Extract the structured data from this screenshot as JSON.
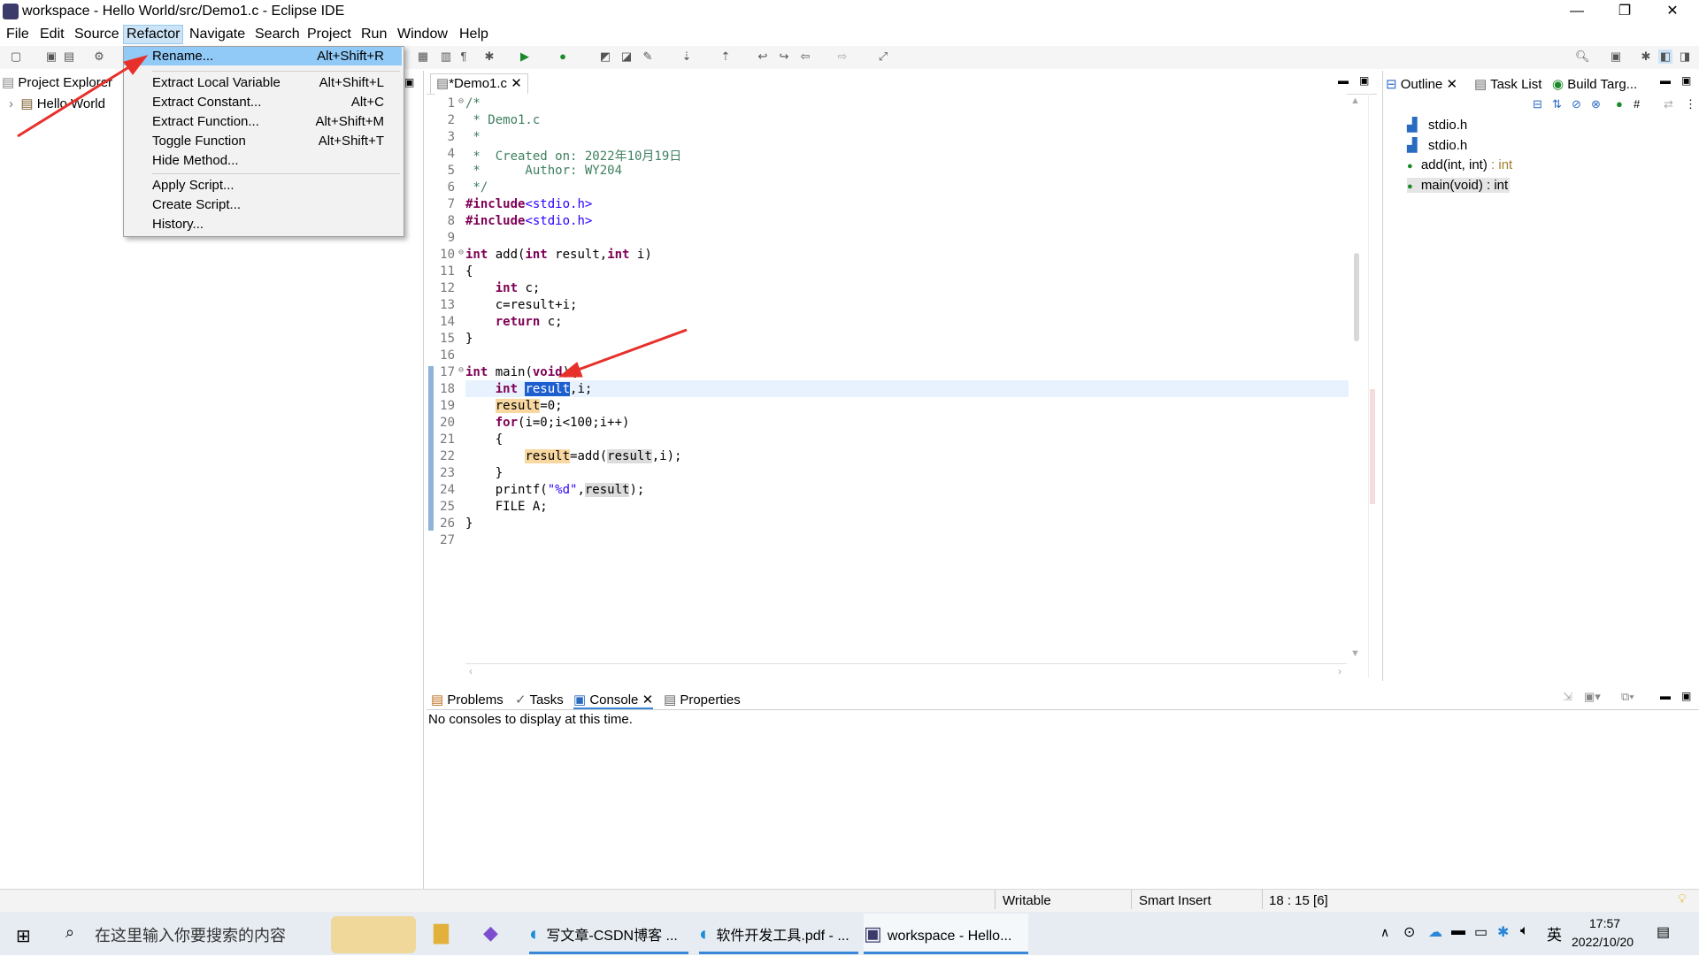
{
  "window": {
    "title": "workspace - Hello World/src/Demo1.c - Eclipse IDE",
    "min": "—",
    "max": "❐",
    "close": "✕"
  },
  "menubar": [
    "File",
    "Edit",
    "Source",
    "Refactor",
    "Navigate",
    "Search",
    "Project",
    "Run",
    "Window",
    "Help"
  ],
  "refactor_menu": {
    "group1": [
      {
        "label": "Rename...",
        "accel": "Alt+Shift+R"
      }
    ],
    "group2": [
      {
        "label": "Extract Local Variable",
        "accel": "Alt+Shift+L"
      },
      {
        "label": "Extract Constant...",
        "accel": "Alt+C"
      },
      {
        "label": "Extract Function...",
        "accel": "Alt+Shift+M"
      },
      {
        "label": "Toggle Function",
        "accel": "Alt+Shift+T"
      },
      {
        "label": "Hide Method...",
        "accel": ""
      }
    ],
    "group3": [
      {
        "label": "Apply Script...",
        "accel": ""
      },
      {
        "label": "Create Script...",
        "accel": ""
      },
      {
        "label": "History...",
        "accel": ""
      }
    ]
  },
  "project_explorer": {
    "tab": "Project Explorer",
    "items": [
      "Hello World"
    ]
  },
  "editor": {
    "tab": "*Demo1.c",
    "line_numbers": [
      "1",
      "2",
      "3",
      "4",
      "5",
      "6",
      "7",
      "8",
      "9",
      "10",
      "11",
      "12",
      "13",
      "14",
      "15",
      "16",
      "17",
      "18",
      "19",
      "20",
      "21",
      "22",
      "23",
      "24",
      "25",
      "26",
      "27"
    ],
    "lines": [
      "/*",
      " * Demo1.c",
      " *",
      " *  Created on: 2022年10月19日",
      " *      Author: WY204",
      " */",
      "#include<stdio.h>",
      "#include<stdio.h>",
      "",
      "int add(int result,int i)",
      "{",
      "    int c;",
      "    c=result+i;",
      "    return c;",
      "}",
      "",
      "int main(void){",
      "    int result,i;",
      "    result=0;",
      "    for(i=0;i<100;i++)",
      "    {",
      "        result=add(result,i);",
      "    }",
      "    printf(\"%d\",result);",
      "    FILE A;",
      "}",
      ""
    ],
    "selected_word": "result"
  },
  "outline": {
    "tabs": [
      "Outline",
      "Task List",
      "Build Targ..."
    ],
    "items": [
      {
        "name": "stdio.h",
        "type": ""
      },
      {
        "name": "stdio.h",
        "type": ""
      },
      {
        "name": "add(int, int)",
        "type": " : int"
      },
      {
        "name": "main(void)",
        "type": " : int"
      }
    ]
  },
  "console": {
    "tabs": [
      "Problems",
      "Tasks",
      "Console",
      "Properties"
    ],
    "message": "No consoles to display at this time."
  },
  "status": {
    "writable": "Writable",
    "insert_mode": "Smart Insert",
    "position": "18 : 15 [6]"
  },
  "taskbar": {
    "search_placeholder": "在这里输入你要搜索的内容",
    "tasks": [
      "写文章-CSDN博客 ...",
      "软件开发工具.pdf - ...",
      "workspace - Hello..."
    ],
    "ime": "英",
    "time": "17:57",
    "date": "2022/10/20"
  },
  "colors": {
    "keyword": "#7f0055",
    "comment": "#3f7f5f",
    "string": "#2a00ff",
    "selection": "#1e5fd0",
    "menu_highlight": "#91c9f7",
    "arrow": "#e8302a"
  }
}
